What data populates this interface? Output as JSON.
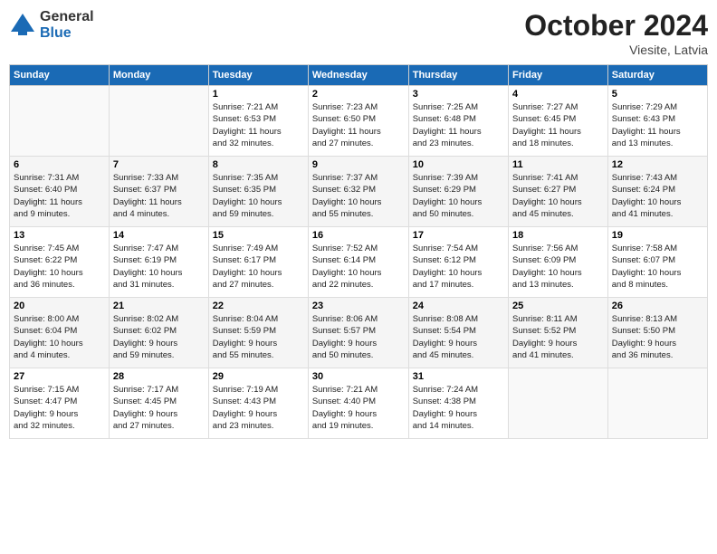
{
  "logo": {
    "general": "General",
    "blue": "Blue"
  },
  "title": "October 2024",
  "location": "Viesite, Latvia",
  "days_of_week": [
    "Sunday",
    "Monday",
    "Tuesday",
    "Wednesday",
    "Thursday",
    "Friday",
    "Saturday"
  ],
  "weeks": [
    [
      {
        "day": "",
        "info": ""
      },
      {
        "day": "",
        "info": ""
      },
      {
        "day": "1",
        "info": "Sunrise: 7:21 AM\nSunset: 6:53 PM\nDaylight: 11 hours\nand 32 minutes."
      },
      {
        "day": "2",
        "info": "Sunrise: 7:23 AM\nSunset: 6:50 PM\nDaylight: 11 hours\nand 27 minutes."
      },
      {
        "day": "3",
        "info": "Sunrise: 7:25 AM\nSunset: 6:48 PM\nDaylight: 11 hours\nand 23 minutes."
      },
      {
        "day": "4",
        "info": "Sunrise: 7:27 AM\nSunset: 6:45 PM\nDaylight: 11 hours\nand 18 minutes."
      },
      {
        "day": "5",
        "info": "Sunrise: 7:29 AM\nSunset: 6:43 PM\nDaylight: 11 hours\nand 13 minutes."
      }
    ],
    [
      {
        "day": "6",
        "info": "Sunrise: 7:31 AM\nSunset: 6:40 PM\nDaylight: 11 hours\nand 9 minutes."
      },
      {
        "day": "7",
        "info": "Sunrise: 7:33 AM\nSunset: 6:37 PM\nDaylight: 11 hours\nand 4 minutes."
      },
      {
        "day": "8",
        "info": "Sunrise: 7:35 AM\nSunset: 6:35 PM\nDaylight: 10 hours\nand 59 minutes."
      },
      {
        "day": "9",
        "info": "Sunrise: 7:37 AM\nSunset: 6:32 PM\nDaylight: 10 hours\nand 55 minutes."
      },
      {
        "day": "10",
        "info": "Sunrise: 7:39 AM\nSunset: 6:29 PM\nDaylight: 10 hours\nand 50 minutes."
      },
      {
        "day": "11",
        "info": "Sunrise: 7:41 AM\nSunset: 6:27 PM\nDaylight: 10 hours\nand 45 minutes."
      },
      {
        "day": "12",
        "info": "Sunrise: 7:43 AM\nSunset: 6:24 PM\nDaylight: 10 hours\nand 41 minutes."
      }
    ],
    [
      {
        "day": "13",
        "info": "Sunrise: 7:45 AM\nSunset: 6:22 PM\nDaylight: 10 hours\nand 36 minutes."
      },
      {
        "day": "14",
        "info": "Sunrise: 7:47 AM\nSunset: 6:19 PM\nDaylight: 10 hours\nand 31 minutes."
      },
      {
        "day": "15",
        "info": "Sunrise: 7:49 AM\nSunset: 6:17 PM\nDaylight: 10 hours\nand 27 minutes."
      },
      {
        "day": "16",
        "info": "Sunrise: 7:52 AM\nSunset: 6:14 PM\nDaylight: 10 hours\nand 22 minutes."
      },
      {
        "day": "17",
        "info": "Sunrise: 7:54 AM\nSunset: 6:12 PM\nDaylight: 10 hours\nand 17 minutes."
      },
      {
        "day": "18",
        "info": "Sunrise: 7:56 AM\nSunset: 6:09 PM\nDaylight: 10 hours\nand 13 minutes."
      },
      {
        "day": "19",
        "info": "Sunrise: 7:58 AM\nSunset: 6:07 PM\nDaylight: 10 hours\nand 8 minutes."
      }
    ],
    [
      {
        "day": "20",
        "info": "Sunrise: 8:00 AM\nSunset: 6:04 PM\nDaylight: 10 hours\nand 4 minutes."
      },
      {
        "day": "21",
        "info": "Sunrise: 8:02 AM\nSunset: 6:02 PM\nDaylight: 9 hours\nand 59 minutes."
      },
      {
        "day": "22",
        "info": "Sunrise: 8:04 AM\nSunset: 5:59 PM\nDaylight: 9 hours\nand 55 minutes."
      },
      {
        "day": "23",
        "info": "Sunrise: 8:06 AM\nSunset: 5:57 PM\nDaylight: 9 hours\nand 50 minutes."
      },
      {
        "day": "24",
        "info": "Sunrise: 8:08 AM\nSunset: 5:54 PM\nDaylight: 9 hours\nand 45 minutes."
      },
      {
        "day": "25",
        "info": "Sunrise: 8:11 AM\nSunset: 5:52 PM\nDaylight: 9 hours\nand 41 minutes."
      },
      {
        "day": "26",
        "info": "Sunrise: 8:13 AM\nSunset: 5:50 PM\nDaylight: 9 hours\nand 36 minutes."
      }
    ],
    [
      {
        "day": "27",
        "info": "Sunrise: 7:15 AM\nSunset: 4:47 PM\nDaylight: 9 hours\nand 32 minutes."
      },
      {
        "day": "28",
        "info": "Sunrise: 7:17 AM\nSunset: 4:45 PM\nDaylight: 9 hours\nand 27 minutes."
      },
      {
        "day": "29",
        "info": "Sunrise: 7:19 AM\nSunset: 4:43 PM\nDaylight: 9 hours\nand 23 minutes."
      },
      {
        "day": "30",
        "info": "Sunrise: 7:21 AM\nSunset: 4:40 PM\nDaylight: 9 hours\nand 19 minutes."
      },
      {
        "day": "31",
        "info": "Sunrise: 7:24 AM\nSunset: 4:38 PM\nDaylight: 9 hours\nand 14 minutes."
      },
      {
        "day": "",
        "info": ""
      },
      {
        "day": "",
        "info": ""
      }
    ]
  ]
}
